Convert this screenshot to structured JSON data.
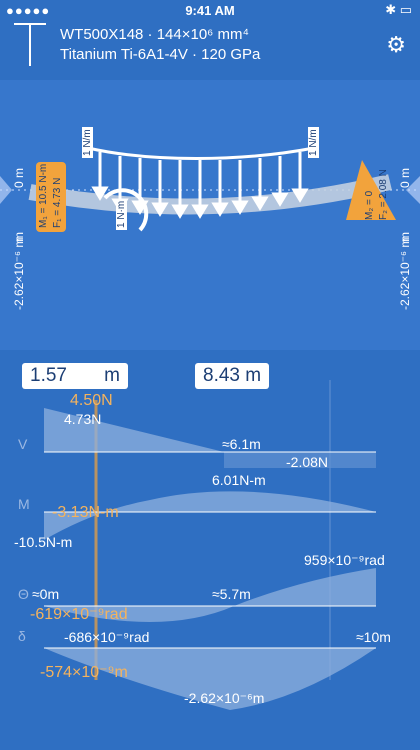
{
  "status": {
    "time": "9:41 AM",
    "signal": "●●●●● ",
    "battery": "✱ ▭"
  },
  "header": {
    "line1": "WT500X148 · 144×10⁶ mm⁴",
    "line2": "Titanium Ti-6A1-4V · 120 GPa"
  },
  "beam": {
    "left_top": "0 m",
    "left_mid": "-2.62×10⁻⁶ m",
    "left_bottom": "m",
    "right_top": "0 m",
    "right_mid": "-2.62×10⁻⁶ m",
    "right_bottom": "m",
    "load_left": "1 N/m",
    "load_right": "1 N/m",
    "moment": "1 N·m",
    "left_support_f": "F₁ = 4.73 N",
    "left_support_m": "M₁ = 10.5 N-m",
    "right_support_f": "F₂ = 2.08 N",
    "right_support_m": "M₂ = 0"
  },
  "inputs": {
    "pos1": "1.57",
    "unit1": "m",
    "pos2": "8.43 m"
  },
  "graphs": {
    "V": {
      "label": "V",
      "v1": "4.50N",
      "v2": "4.73N",
      "zero": "≈6.1m",
      "end": "-2.08N"
    },
    "M": {
      "label": "M",
      "max": "6.01N-m",
      "cur": "-3.13N-m",
      "start": "-10.5N-m"
    },
    "theta": {
      "label": "Θ",
      "start": "≈0m",
      "max": "959×10⁻⁹rad",
      "zero": "≈5.7m",
      "cur": "-619×10⁻⁹rad"
    },
    "delta": {
      "label": "δ",
      "start": "-686×10⁻⁹rad",
      "end": "≈10m",
      "cur": "-574×10⁻⁹m",
      "min": "-2.62×10⁻⁶m"
    }
  }
}
